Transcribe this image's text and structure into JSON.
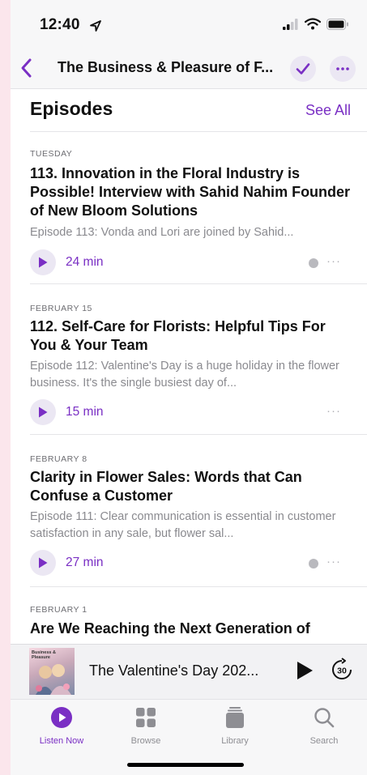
{
  "status": {
    "time": "12:40"
  },
  "nav": {
    "title": "The Business & Pleasure of F..."
  },
  "section": {
    "title": "Episodes",
    "see_all": "See All"
  },
  "episodes": [
    {
      "date": "TUESDAY",
      "title": "113. Innovation in the Floral Industry is Possible! Interview with Sahid Nahim Founder of New Bloom Solutions",
      "desc": "Episode 113: Vonda and Lori are joined by Sahid...",
      "duration": "24 min",
      "more": "···"
    },
    {
      "date": "FEBRUARY 15",
      "title": "112. Self-Care for Florists: Helpful Tips For You & Your Team",
      "desc": "Episode 112: Valentine's Day is a huge holiday in the flower business. It's the single busiest day of...",
      "duration": "15 min",
      "more": "···"
    },
    {
      "date": "FEBRUARY 8",
      "title": "Clarity in Flower Sales: Words that Can Confuse a Customer",
      "desc": "Episode 111: Clear communication is essential in customer satisfaction in any sale, but flower sal...",
      "duration": "27 min",
      "more": "···"
    },
    {
      "date": "FEBRUARY 1",
      "title": "Are We Reaching the Next Generation of"
    }
  ],
  "player": {
    "title": "The Valentine's Day 202...",
    "skip_seconds": "30",
    "art_text": "Business & Pleasure"
  },
  "tabs": [
    {
      "label": "Listen Now",
      "icon": "play-circle-icon",
      "active": true
    },
    {
      "label": "Browse",
      "icon": "grid-icon",
      "active": false
    },
    {
      "label": "Library",
      "icon": "stack-icon",
      "active": false
    },
    {
      "label": "Search",
      "icon": "search-icon",
      "active": false
    }
  ],
  "colors": {
    "accent": "#7a2fc4",
    "accent_bg": "#ebe7f3",
    "page_bg": "#fbe6ec"
  }
}
